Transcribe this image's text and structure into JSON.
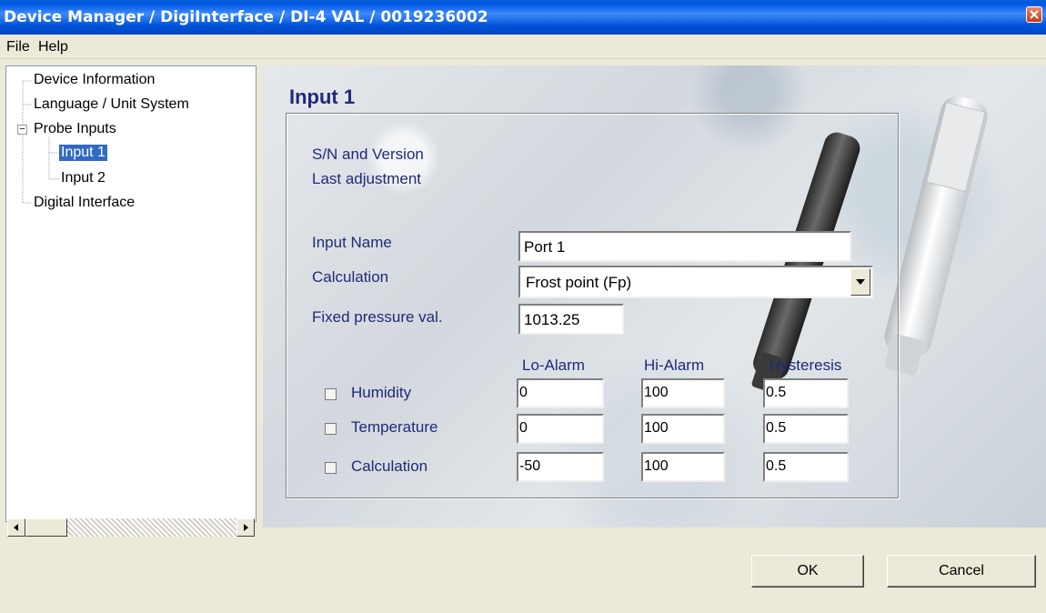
{
  "window": {
    "title": "Device Manager / DigiInterface / DI-4 VAL / 0019236002"
  },
  "menu": {
    "file": "File",
    "help": "Help"
  },
  "tree": {
    "device_information": "Device Information",
    "language_unit_system": "Language / Unit System",
    "probe_inputs": "Probe Inputs",
    "probe_inputs_expander": "−",
    "input_1": "Input 1",
    "input_2": "Input 2",
    "digital_interface": "Digital Interface"
  },
  "panel": {
    "title": "Input 1",
    "sn_version_label": "S/N and Version",
    "last_adjustment_label": "Last adjustment",
    "input_name_label": "Input Name",
    "input_name_value": "Port 1",
    "calculation_label": "Calculation",
    "calculation_value": "Frost point (Fp)",
    "fixed_pressure_label": "Fixed pressure val.",
    "fixed_pressure_value": "1013.25"
  },
  "alarms": {
    "headers": {
      "lo": "Lo-Alarm",
      "hi": "Hi-Alarm",
      "hysteresis": "Hysteresis"
    },
    "rows": [
      {
        "label": "Humidity",
        "lo": "0",
        "hi": "100",
        "hysteresis": "0.5",
        "checked": false
      },
      {
        "label": "Temperature",
        "lo": "0",
        "hi": "100",
        "hysteresis": "0.5",
        "checked": false
      },
      {
        "label": "Calculation",
        "lo": "-50",
        "hi": "100",
        "hysteresis": "0.5",
        "checked": false
      }
    ]
  },
  "buttons": {
    "ok": "OK",
    "cancel": "Cancel"
  },
  "colors": {
    "title_bar": "#0058e6",
    "selection": "#316ac5",
    "label_text": "#1f2a7a"
  }
}
